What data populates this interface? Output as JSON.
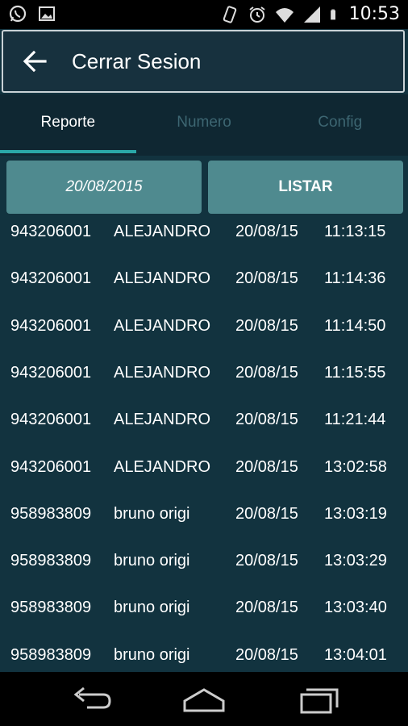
{
  "status_bar": {
    "time": "10:53",
    "left_icons": [
      "whatsapp-icon",
      "image-icon"
    ],
    "right_icons": [
      "vibrate-icon",
      "alarm-icon",
      "wifi-icon",
      "signal-icon",
      "battery-icon"
    ]
  },
  "app_bar": {
    "title": "Cerrar Sesion",
    "back_icon": "arrow-left-icon"
  },
  "tabs": [
    {
      "label": "Reporte",
      "active": true
    },
    {
      "label": "Numero",
      "active": false
    },
    {
      "label": "Config",
      "active": false
    }
  ],
  "actions": {
    "date_value": "20/08/2015",
    "list_label": "LISTAR"
  },
  "records": [
    {
      "number": "943206001",
      "name": "ALEJANDRO",
      "date": "20/08/15",
      "time": "11:13:15"
    },
    {
      "number": "943206001",
      "name": "ALEJANDRO",
      "date": "20/08/15",
      "time": "11:14:36"
    },
    {
      "number": "943206001",
      "name": "ALEJANDRO",
      "date": "20/08/15",
      "time": "11:14:50"
    },
    {
      "number": "943206001",
      "name": "ALEJANDRO",
      "date": "20/08/15",
      "time": "11:15:55"
    },
    {
      "number": "943206001",
      "name": "ALEJANDRO",
      "date": "20/08/15",
      "time": "11:21:44"
    },
    {
      "number": "943206001",
      "name": "ALEJANDRO",
      "date": "20/08/15",
      "time": "13:02:58"
    },
    {
      "number": "958983809",
      "name": "bruno origi",
      "date": "20/08/15",
      "time": "13:03:19"
    },
    {
      "number": "958983809",
      "name": "bruno origi",
      "date": "20/08/15",
      "time": "13:03:29"
    },
    {
      "number": "958983809",
      "name": "bruno origi",
      "date": "20/08/15",
      "time": "13:03:40"
    },
    {
      "number": "958983809",
      "name": "bruno origi",
      "date": "20/08/15",
      "time": "13:04:01"
    }
  ],
  "nav_bar": {
    "icons": [
      "back-nav-icon",
      "home-nav-icon",
      "recents-nav-icon"
    ]
  },
  "colors": {
    "background": "#12333f",
    "button": "#4f8a8f",
    "tab_indicator": "#2aa8a8",
    "tab_inactive": "#3d6672"
  }
}
